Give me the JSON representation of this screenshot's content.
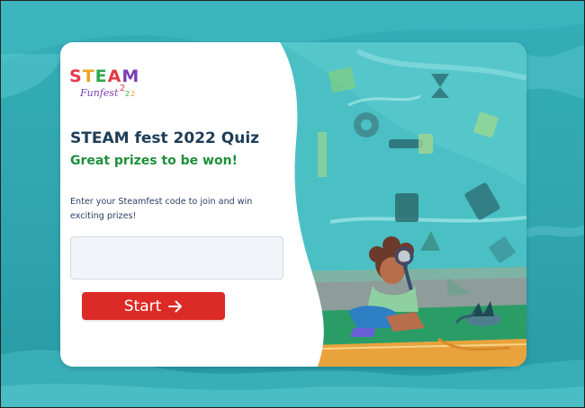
{
  "logo": {
    "line1": "STEAM",
    "line2": "Funfest",
    "year_digits": [
      "2",
      "2",
      "2"
    ]
  },
  "quiz": {
    "title": "STEAM fest 2022 Quiz",
    "subtitle": "Great prizes to be won!",
    "description": "Enter your Steamfest code to join and win exciting prizes!",
    "code_input_value": "",
    "code_input_placeholder": "",
    "start_label": "Start",
    "start_icon": "arrow-right-icon"
  },
  "colors": {
    "background": "#34aeb8",
    "title": "#1e3d57",
    "subtitle": "#1f8f3a",
    "start_button": "#dc2b27",
    "input_bg": "#f1f4f8"
  }
}
